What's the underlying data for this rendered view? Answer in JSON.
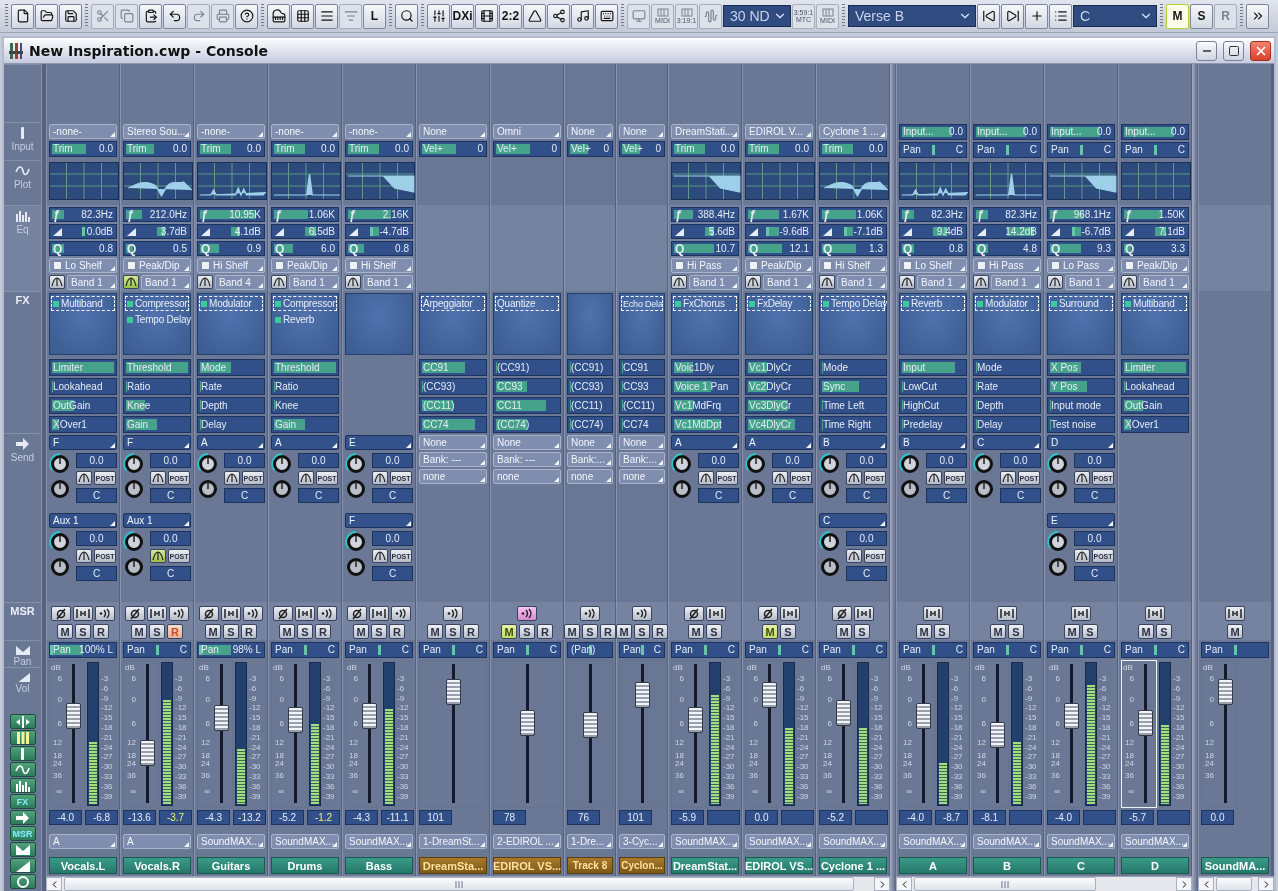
{
  "toolbar": {
    "groups": [
      [
        {
          "kind": "icon",
          "disabled": false
        },
        {
          "kind": "icon",
          "disabled": false
        },
        {
          "kind": "icon",
          "disabled": false
        }
      ],
      [
        {
          "kind": "icon",
          "disabled": true
        },
        {
          "kind": "icon",
          "disabled": true
        },
        {
          "kind": "icon",
          "disabled": false
        },
        {
          "kind": "icon",
          "disabled": false
        },
        {
          "kind": "icon",
          "disabled": true
        },
        {
          "kind": "icon",
          "disabled": true
        },
        {
          "kind": "icon",
          "disabled": false
        }
      ],
      [
        {
          "kind": "icon",
          "disabled": false
        },
        {
          "kind": "icon",
          "disabled": false
        },
        {
          "kind": "icon",
          "disabled": false
        },
        {
          "kind": "icon",
          "disabled": true
        },
        {
          "kind": "text",
          "label": "L",
          "disabled": false
        }
      ],
      [
        {
          "kind": "icon",
          "disabled": false
        }
      ],
      [
        {
          "kind": "icon",
          "disabled": false
        },
        {
          "kind": "text",
          "label": "DXi",
          "disabled": false
        },
        {
          "kind": "icon",
          "disabled": false
        },
        {
          "kind": "text",
          "label": "2:2",
          "disabled": false
        },
        {
          "kind": "icon",
          "disabled": false
        },
        {
          "kind": "icon",
          "disabled": false
        },
        {
          "kind": "icon",
          "disabled": false
        },
        {
          "kind": "icon",
          "disabled": false
        }
      ],
      [
        {
          "kind": "icon",
          "disabled": true
        },
        {
          "kind": "stack",
          "label": "MIDI",
          "disabled": true
        },
        {
          "kind": "stack",
          "label": "3:19:1",
          "disabled": true
        },
        {
          "kind": "icon",
          "disabled": true
        },
        {
          "kind": "select",
          "label": "30 ND",
          "disabled": false
        },
        {
          "kind": "stack",
          "top": "3:59:1",
          "label": "MTC",
          "disabled": true
        },
        {
          "kind": "stack",
          "label": "MIDI",
          "disabled": true
        }
      ],
      [
        {
          "kind": "select",
          "label": "Verse B",
          "disabled": false
        },
        {
          "kind": "icon",
          "disabled": false
        },
        {
          "kind": "icon",
          "disabled": false
        },
        {
          "kind": "icon",
          "disabled": false
        },
        {
          "kind": "icon",
          "disabled": false
        },
        {
          "kind": "select",
          "label": "C",
          "disabled": false
        }
      ],
      [
        {
          "kind": "text",
          "label": "M",
          "disabled": false,
          "selected": true
        },
        {
          "kind": "text",
          "label": "S",
          "disabled": false,
          "selected": false
        },
        {
          "kind": "text",
          "label": "R",
          "disabled": true,
          "selected": false
        }
      ],
      [
        {
          "kind": "icon",
          "disabled": false
        }
      ]
    ]
  },
  "window": {
    "title": "New Inspiration.cwp - Console"
  },
  "sidebar": {
    "sections": [
      {
        "label": "Input"
      },
      {
        "label": "Plot"
      },
      {
        "label": "Eq"
      },
      {
        "label": "FX"
      },
      {
        "label": "Send"
      },
      {
        "label": "MSR"
      },
      {
        "label": "Pan"
      },
      {
        "label": "Vol"
      }
    ],
    "toggles": [
      {
        "kind": "icon"
      },
      {
        "kind": "icon"
      },
      {
        "kind": "icon"
      },
      {
        "kind": "icon"
      },
      {
        "kind": "icon"
      },
      {
        "kind": "text",
        "label": "FX"
      },
      {
        "kind": "icon"
      },
      {
        "kind": "text",
        "label": "MSR"
      },
      {
        "kind": "icon"
      },
      {
        "kind": "icon"
      },
      {
        "kind": "icon"
      }
    ]
  },
  "strips": [
    {
      "kind": "audio",
      "compact": false,
      "input": "-none-",
      "trim": {
        "label": "Trim",
        "value": "0.0",
        "level": 0.55
      },
      "eq": {
        "freq": {
          "symbol": "ƒ",
          "value": "82.3Hz",
          "level": 0.2
        },
        "gain": {
          "value": "0.0dB",
          "level": 0.5
        },
        "q": {
          "symbol": "Q",
          "value": "0.8",
          "level": 0.2
        },
        "type": "Lo Shelf",
        "enabled": false,
        "band": "Band 1",
        "band_on": false
      },
      "fx": [
        {
          "name": "Multiband",
          "selected": true
        }
      ],
      "params": [
        {
          "label": "Limiter",
          "level": 1
        },
        {
          "label": "Lookahead",
          "level": 0
        },
        {
          "label": "OutGain",
          "level": 0.35
        },
        {
          "label": "XOver1",
          "level": 0.12
        }
      ],
      "sends": [
        {
          "bus": "F",
          "value": "0.0",
          "mode": "POST",
          "pan": "C",
          "linked": false
        },
        {
          "bus": "Aux 1",
          "value": "0.0",
          "mode": "POST",
          "pan": "C",
          "linked": false
        }
      ],
      "msr_icons": [
        {
          "kind": "phase",
          "on": false
        },
        {
          "kind": "interleave",
          "on": false
        },
        {
          "kind": "echo",
          "on": false
        }
      ],
      "msr": [
        {
          "label": "M",
          "on": false
        },
        {
          "label": "S",
          "on": false
        },
        {
          "label": "R",
          "on": false
        }
      ],
      "pan": {
        "label": "Pan",
        "value": "100% L",
        "level": 0
      },
      "fader": {
        "level": 0.63,
        "value": "-4.0",
        "focused": false
      },
      "meter": {
        "level": 0.45,
        "value": "-6.8",
        "hot": false
      },
      "db": "dB",
      "scale": [
        "6",
        "0",
        "6",
        "12",
        "18",
        "24",
        "36",
        "∞"
      ],
      "meter_scale": [
        "-3",
        "-6",
        "-9",
        "-12",
        "-15",
        "-18",
        "-21",
        "-24",
        "-27",
        "-30",
        "-33",
        "-36",
        "-39"
      ],
      "output": "A",
      "name": "Vocals.L"
    },
    {
      "kind": "audio",
      "compact": false,
      "input": "Stereo Sou...",
      "trim": {
        "label": "Trim",
        "value": "0.0",
        "level": 0.45
      },
      "eq": {
        "freq": {
          "symbol": "ƒ",
          "value": "212.0Hz",
          "level": 0.25
        },
        "gain": {
          "value": "3.7dB",
          "level": 0.6
        },
        "q": {
          "symbol": "Q",
          "value": "0.5",
          "level": 0.12
        },
        "type": "Peak/Dip",
        "enabled": false,
        "band": "Band 1",
        "band_on": true
      },
      "fx": [
        {
          "name": "Compressor",
          "selected": true
        },
        {
          "name": "Tempo Delay",
          "selected": false
        }
      ],
      "params": [
        {
          "label": "Threshold",
          "level": 1
        },
        {
          "label": "Ratio",
          "level": 0
        },
        {
          "label": "Knee",
          "level": 0.3
        },
        {
          "label": "Gain",
          "level": 0.5
        }
      ],
      "sends": [
        {
          "bus": "F",
          "value": "0.0",
          "mode": "POST",
          "pan": "C",
          "linked": false
        },
        {
          "bus": "Aux 1",
          "value": "0.0",
          "mode": "POST",
          "pan": "C",
          "linked": true
        }
      ],
      "msr_icons": [
        {
          "kind": "phase",
          "on": false
        },
        {
          "kind": "interleave",
          "on": false
        },
        {
          "kind": "echo",
          "on": false
        }
      ],
      "msr": [
        {
          "label": "M",
          "on": false
        },
        {
          "label": "S",
          "on": false
        },
        {
          "label": "R",
          "on": true
        }
      ],
      "pan": {
        "label": "Pan",
        "value": "C",
        "level": 0.5
      },
      "fader": {
        "level": 0.37,
        "value": "-13.6",
        "focused": false
      },
      "meter": {
        "level": 0.75,
        "value": "-3.7",
        "hot": true
      },
      "db": "dB",
      "scale": [
        "6",
        "0",
        "6",
        "12",
        "18",
        "24",
        "36",
        "∞"
      ],
      "meter_scale": [
        "-3",
        "-6",
        "-9",
        "-12",
        "-15",
        "-18",
        "-21",
        "-24",
        "-27",
        "-30",
        "-33",
        "-36",
        "-39"
      ],
      "output": "A",
      "name": "Vocals.R"
    },
    {
      "kind": "audio",
      "compact": false,
      "input": "-none-",
      "trim": {
        "label": "Trim",
        "value": "0.0",
        "level": 0.5
      },
      "eq": {
        "freq": {
          "symbol": "ƒ",
          "value": "10.95K",
          "level": 0.9
        },
        "gain": {
          "value": "4.1dB",
          "level": 0.62
        },
        "q": {
          "symbol": "Q",
          "value": "0.9",
          "level": 0.3
        },
        "type": "Hi Shelf",
        "enabled": false,
        "band": "Band 4",
        "band_on": false
      },
      "fx": [
        {
          "name": "Modulator",
          "selected": true
        }
      ],
      "params": [
        {
          "label": "Mode",
          "level": 0.5
        },
        {
          "label": "Rate",
          "level": 0
        },
        {
          "label": "Depth",
          "level": 0
        },
        {
          "label": "Delay",
          "level": 0
        }
      ],
      "sends": [
        {
          "bus": "A",
          "value": "0.0",
          "mode": "POST",
          "pan": "C",
          "linked": false
        }
      ],
      "msr_icons": [
        {
          "kind": "phase",
          "on": false
        },
        {
          "kind": "interleave",
          "on": false
        },
        {
          "kind": "echo",
          "on": false
        }
      ],
      "msr": [
        {
          "label": "M",
          "on": false
        },
        {
          "label": "S",
          "on": false
        },
        {
          "label": "R",
          "on": false
        }
      ],
      "pan": {
        "label": "Pan",
        "value": "98% L",
        "level": 0.01
      },
      "fader": {
        "level": 0.62,
        "value": "-4.3",
        "focused": false
      },
      "meter": {
        "level": 0.4,
        "value": "-13.2",
        "hot": false
      },
      "db": "dB",
      "scale": [
        "6",
        "0",
        "6",
        "12",
        "18",
        "24",
        "36",
        "∞"
      ],
      "meter_scale": [
        "-3",
        "-6",
        "-9",
        "-12",
        "-15",
        "-18",
        "-21",
        "-24",
        "-27",
        "-30",
        "-33",
        "-36",
        "-39"
      ],
      "output": "SoundMAX...",
      "name": "Guitars"
    },
    {
      "kind": "audio",
      "compact": false,
      "input": "-none-",
      "trim": {
        "label": "Trim",
        "value": "0.0",
        "level": 0.5
      },
      "eq": {
        "freq": {
          "symbol": "ƒ",
          "value": "1.06K",
          "level": 0.55
        },
        "gain": {
          "value": "6.5dB",
          "level": 0.65
        },
        "q": {
          "symbol": "Q",
          "value": "6.0",
          "level": 0.3
        },
        "type": "Peak/Dip",
        "enabled": false,
        "band": "Band 1",
        "band_on": false
      },
      "fx": [
        {
          "name": "Compressor",
          "selected": true
        },
        {
          "name": "Reverb",
          "selected": false
        }
      ],
      "params": [
        {
          "label": "Threshold",
          "level": 1
        },
        {
          "label": "Ratio",
          "level": 0
        },
        {
          "label": "Knee",
          "level": 0
        },
        {
          "label": "Gain",
          "level": 0.5
        }
      ],
      "sends": [
        {
          "bus": "A",
          "value": "0.0",
          "mode": "POST",
          "pan": "C",
          "linked": false
        }
      ],
      "msr_icons": [
        {
          "kind": "phase",
          "on": false
        },
        {
          "kind": "interleave",
          "on": false
        },
        {
          "kind": "echo",
          "on": false
        }
      ],
      "msr": [
        {
          "label": "M",
          "on": false
        },
        {
          "label": "S",
          "on": false
        },
        {
          "label": "R",
          "on": false
        }
      ],
      "pan": {
        "label": "Pan",
        "value": "C",
        "level": 0.5
      },
      "fader": {
        "level": 0.6,
        "value": "-5.2",
        "focused": false
      },
      "meter": {
        "level": 0.58,
        "value": "-1.2",
        "hot": true
      },
      "db": "dB",
      "scale": [
        "6",
        "0",
        "6",
        "12",
        "18",
        "24",
        "36",
        "∞"
      ],
      "meter_scale": [
        "-3",
        "-6",
        "-9",
        "-12",
        "-15",
        "-18",
        "-21",
        "-24",
        "-27",
        "-30",
        "-33",
        "-36",
        "-39"
      ],
      "output": "SoundMAX...",
      "name": "Drums"
    },
    {
      "kind": "audio",
      "compact": false,
      "input": "-none-",
      "trim": {
        "label": "Trim",
        "value": "0.0",
        "level": 0.5
      },
      "eq": {
        "freq": {
          "symbol": "ƒ",
          "value": "2.16K",
          "level": 0.7
        },
        "gain": {
          "value": "-4.7dB",
          "level": 0.38
        },
        "q": {
          "symbol": "Q",
          "value": "0.8",
          "level": 0.25
        },
        "type": "Hi Shelf",
        "enabled": false,
        "band": "Band 1",
        "band_on": false
      },
      "sends": [
        {
          "bus": "E",
          "value": "0.0",
          "mode": "POST",
          "pan": "C",
          "linked": false
        },
        {
          "bus": "F",
          "value": "0.0",
          "mode": "POST",
          "pan": "C",
          "linked": false
        }
      ],
      "msr_icons": [
        {
          "kind": "phase",
          "on": false
        },
        {
          "kind": "interleave",
          "on": false
        },
        {
          "kind": "echo",
          "on": false
        }
      ],
      "msr": [
        {
          "label": "M",
          "on": false
        },
        {
          "label": "S",
          "on": false
        },
        {
          "label": "R",
          "on": false
        }
      ],
      "pan": {
        "label": "Pan",
        "value": "C",
        "level": 0.5
      },
      "fader": {
        "level": 0.63,
        "value": "-4.3",
        "focused": false
      },
      "meter": {
        "level": 0.68,
        "value": "-11.1",
        "hot": false
      },
      "db": "dB",
      "scale": [
        "6",
        "0",
        "6",
        "12",
        "18",
        "24",
        "36",
        "∞"
      ],
      "meter_scale": [
        "-3",
        "-6",
        "-9",
        "-12",
        "-15",
        "-18",
        "-21",
        "-24",
        "-27",
        "-30",
        "-33",
        "-36",
        "-39"
      ],
      "output": "SoundMAX...",
      "name": "Bass"
    },
    {
      "kind": "midi",
      "compact": false,
      "input": "None",
      "trim": {
        "label": "Vel+",
        "value": "0",
        "level": 0.55
      },
      "fx": [
        {
          "name": "Arpeggiator",
          "selected": true
        }
      ],
      "params": [
        {
          "label": "CC91",
          "level": 0.7
        },
        {
          "label": "(CC93)",
          "level": 0
        },
        {
          "label": "(CC11)",
          "level": 0.5
        },
        {
          "label": "CC74",
          "level": 0.85
        }
      ],
      "patch": [
        "None",
        "Bank: ---",
        "none"
      ],
      "msr_icons": [
        {
          "kind": "echo",
          "on": false
        }
      ],
      "msr": [
        {
          "label": "M",
          "on": false
        },
        {
          "label": "S",
          "on": false
        },
        {
          "label": "R",
          "on": false
        }
      ],
      "pan": {
        "label": "Pan",
        "value": "C",
        "level": 0.5
      },
      "fader": {
        "level": 0.8,
        "value": "101",
        "focused": false
      },
      "output": "1-DreamSt...",
      "name": "DreamSta..."
    },
    {
      "kind": "midi",
      "compact": false,
      "input": "Omni",
      "trim": {
        "label": "Vel+",
        "value": "0",
        "level": 0.55
      },
      "fx": [
        {
          "name": "Quantize",
          "selected": true
        }
      ],
      "params": [
        {
          "label": "(CC91)",
          "level": 0
        },
        {
          "label": "CC93",
          "level": 0.5
        },
        {
          "label": "CC11",
          "level": 0.8
        },
        {
          "label": "(CC74)",
          "level": 0.5
        }
      ],
      "patch": [
        "None",
        "Bank: ---",
        "none"
      ],
      "msr_icons": [
        {
          "kind": "echo",
          "on": true
        }
      ],
      "msr": [
        {
          "label": "M",
          "on": true
        },
        {
          "label": "S",
          "on": false
        },
        {
          "label": "R",
          "on": false
        }
      ],
      "pan": {
        "label": "Pan",
        "value": "C",
        "level": 0.5
      },
      "fader": {
        "level": 0.58,
        "value": "78",
        "focused": false
      },
      "output": "2-EDIROL ...",
      "name": "EDIROL VS..."
    },
    {
      "kind": "midi",
      "compact": true,
      "input": "None",
      "trim": {
        "label": "Vel+",
        "value": "0",
        "level": 0.45
      },
      "params": [
        {
          "label": "(CC91)",
          "level": 0
        },
        {
          "label": "(CC93)",
          "level": 0
        },
        {
          "label": "(CC11)",
          "level": 0
        },
        {
          "label": "(CC74)",
          "level": 0
        }
      ],
      "patch": [
        "None",
        "Bank:...",
        "none"
      ],
      "msr_icons": [
        {
          "kind": "echo",
          "on": false
        }
      ],
      "msr": [
        {
          "label": "M",
          "on": false
        },
        {
          "label": "S",
          "on": false
        },
        {
          "label": "R",
          "on": false
        }
      ],
      "pan": {
        "label": "(Pan)",
        "level": 0.5
      },
      "fader": {
        "level": 0.57,
        "value": "76",
        "focused": false
      },
      "output": "1-Dre...",
      "name": "Track 8"
    },
    {
      "kind": "midi",
      "compact": true,
      "input": "None",
      "trim": {
        "label": "Vel+",
        "value": "0",
        "level": 0.45
      },
      "fx": [
        {
          "name": "Echo Dela",
          "selected": true
        }
      ],
      "params": [
        {
          "label": "CC91",
          "level": 0
        },
        {
          "label": "CC93",
          "level": 0
        },
        {
          "label": "(CC11)",
          "level": 0
        },
        {
          "label": "CC74",
          "level": 0
        }
      ],
      "patch": [
        "None",
        "Bank:...",
        "none"
      ],
      "msr_icons": [
        {
          "kind": "echo",
          "on": false
        }
      ],
      "msr": [
        {
          "label": "M",
          "on": false
        },
        {
          "label": "S",
          "on": false
        },
        {
          "label": "R",
          "on": false
        }
      ],
      "pan": {
        "label": "Pan",
        "value": "C",
        "level": 0.5
      },
      "fader": {
        "level": 0.78,
        "value": "101",
        "focused": false
      },
      "output": "3-Cyc...",
      "name": "Cyclon..."
    },
    {
      "kind": "audio",
      "compact": false,
      "input": "DreamStati...",
      "trim": {
        "label": "Trim",
        "value": "0.0",
        "level": 0.5
      },
      "eq": {
        "freq": {
          "symbol": "ƒ",
          "value": "388.4Hz",
          "level": 0.3
        },
        "gain": {
          "value": "5.6dB",
          "level": 0.62
        },
        "q": {
          "symbol": "Q",
          "value": "10.7",
          "level": 0.65
        },
        "type": "Hi Pass",
        "enabled": false,
        "band": "Band 1",
        "band_on": false
      },
      "fx": [
        {
          "name": "FxChorus",
          "selected": true
        }
      ],
      "params": [
        {
          "label": "Voic1Dly",
          "level": 0.3
        },
        {
          "label": "Voice 1 Pan",
          "level": 0.6
        },
        {
          "label": "Vc1MdFrq",
          "level": 0.3
        },
        {
          "label": "Vc1MdDpt",
          "level": 0.75
        }
      ],
      "sends": [
        {
          "bus": "A",
          "value": "0.0",
          "mode": "POST",
          "pan": "C",
          "linked": false
        }
      ],
      "msr_icons": [
        {
          "kind": "phase",
          "on": false
        },
        {
          "kind": "interleave",
          "on": false
        }
      ],
      "msr": [
        {
          "label": "M",
          "on": false
        },
        {
          "label": "S",
          "on": false
        }
      ],
      "pan": {
        "label": "Pan",
        "value": "C",
        "level": 0.5
      },
      "fader": {
        "level": 0.6,
        "value": "-5.9",
        "focused": false
      },
      "meter": {
        "level": 0.78
      },
      "db": "dB",
      "scale": [
        "6",
        "0",
        "6",
        "12",
        "18",
        "24",
        "36",
        "∞"
      ],
      "meter_scale": [
        "-3",
        "-6",
        "-9",
        "-12",
        "-15",
        "-18",
        "-21",
        "-24",
        "-27",
        "-30",
        "-33",
        "-36",
        "-39"
      ],
      "output": "SoundMAX...",
      "name": "DreamStat..."
    },
    {
      "kind": "audio",
      "compact": false,
      "input": "EDIROL V...",
      "trim": {
        "label": "Trim",
        "value": "0.0",
        "level": 0.5
      },
      "eq": {
        "freq": {
          "symbol": "ƒ",
          "value": "1.67K",
          "level": 0.5
        },
        "gain": {
          "value": "-9.6dB",
          "level": 0.32
        },
        "q": {
          "symbol": "Q",
          "value": "12.1",
          "level": 0.55
        },
        "type": "Peak/Dip",
        "enabled": false,
        "band": "Band 1",
        "band_on": false
      },
      "fx": [
        {
          "name": "FxDelay",
          "selected": true
        }
      ],
      "params": [
        {
          "label": "Vc1DlyCr",
          "level": 0.3
        },
        {
          "label": "Vc2DlyCr",
          "level": 0.3
        },
        {
          "label": "Vc3DlyCr",
          "level": 0.65
        },
        {
          "label": "Vc4DlyCr",
          "level": 0.75
        }
      ],
      "sends": [
        {
          "bus": "A",
          "value": "0.0",
          "mode": "POST",
          "pan": "C",
          "linked": false
        }
      ],
      "msr_icons": [
        {
          "kind": "phase",
          "on": false
        },
        {
          "kind": "interleave",
          "on": false
        }
      ],
      "msr": [
        {
          "label": "M",
          "on": true
        },
        {
          "label": "S",
          "on": false
        }
      ],
      "pan": {
        "label": "Pan",
        "value": "C",
        "level": 0.5
      },
      "fader": {
        "level": 0.78,
        "value": "0.0",
        "focused": false
      },
      "meter": {
        "level": 0.55
      },
      "db": "dB",
      "scale": [
        "6",
        "0",
        "6",
        "12",
        "18",
        "24",
        "36",
        "∞"
      ],
      "meter_scale": [
        "-3",
        "-6",
        "-9",
        "-12",
        "-15",
        "-18",
        "-21",
        "-24",
        "-27",
        "-30",
        "-33",
        "-36",
        "-39"
      ],
      "output": "SoundMAX...",
      "name": "EDIROL VS..."
    },
    {
      "kind": "audio",
      "compact": false,
      "input": "Cyclone 1 ...",
      "trim": {
        "label": "Trim",
        "value": "0.0",
        "level": 0.5
      },
      "eq": {
        "freq": {
          "symbol": "ƒ",
          "value": "1.06K",
          "level": 0.55
        },
        "gain": {
          "value": "-7.1dB",
          "level": 0.38
        },
        "q": {
          "symbol": "Q",
          "value": "1.3",
          "level": 0.55
        },
        "type": "Hi Shelf",
        "enabled": false,
        "band": "Band 1",
        "band_on": false
      },
      "fx": [
        {
          "name": "Tempo Delay",
          "selected": true
        }
      ],
      "params": [
        {
          "label": "Mode",
          "level": 0
        },
        {
          "label": "Sync",
          "level": 0.6
        },
        {
          "label": "Time Left",
          "level": 0
        },
        {
          "label": "Time Right",
          "level": 0
        }
      ],
      "sends": [
        {
          "bus": "B",
          "value": "0.0",
          "mode": "POST",
          "pan": "C",
          "linked": false
        },
        {
          "bus": "C",
          "value": "0.0",
          "mode": "POST",
          "pan": "C",
          "linked": false
        }
      ],
      "msr_icons": [
        {
          "kind": "phase",
          "on": false
        },
        {
          "kind": "interleave",
          "on": false
        }
      ],
      "msr": [
        {
          "label": "M",
          "on": false
        },
        {
          "label": "S",
          "on": false
        }
      ],
      "pan": {
        "label": "Pan",
        "value": "C",
        "level": 0.5
      },
      "fader": {
        "level": 0.65,
        "value": "-5.2",
        "focused": false
      },
      "meter": {
        "level": 0.55
      },
      "db": "dB",
      "scale": [
        "6",
        "0",
        "6",
        "12",
        "18",
        "24",
        "36",
        "∞"
      ],
      "meter_scale": [
        "-3",
        "-6",
        "-9",
        "-12",
        "-15",
        "-18",
        "-21",
        "-24",
        "-27",
        "-30",
        "-33",
        "-36",
        "-39"
      ],
      "output": "SoundMAX...",
      "name": "Cyclone 1 ..."
    },
    {
      "kind": "bus",
      "compact": false,
      "input": {
        "label": "Input...",
        "value": "0.0",
        "level": 0.8
      },
      "trim": {
        "label": "Pan",
        "value": "C",
        "level": 0.5
      },
      "eq": {
        "freq": {
          "symbol": "ƒ",
          "value": "82.3Hz",
          "level": 0.2
        },
        "gain": {
          "value": "9.4dB",
          "level": 0.7
        },
        "q": {
          "symbol": "Q",
          "value": "0.8",
          "level": 0.2
        },
        "type": "Lo Shelf",
        "enabled": false,
        "band": "Band 1",
        "band_on": false
      },
      "fx": [
        {
          "name": "Reverb",
          "selected": true
        }
      ],
      "params": [
        {
          "label": "Input",
          "level": 0.85
        },
        {
          "label": "LowCut",
          "level": 0
        },
        {
          "label": "HighCut",
          "level": 0
        },
        {
          "label": "Predelay",
          "level": 0
        }
      ],
      "sends": [
        {
          "bus": "B",
          "value": "0.0",
          "mode": "POST",
          "pan": "C",
          "linked": false
        }
      ],
      "msr_icons": [
        {
          "kind": "interleave",
          "on": false
        }
      ],
      "msr": [
        {
          "label": "M",
          "on": false
        },
        {
          "label": "S",
          "on": false
        }
      ],
      "pan": {
        "label": "Pan",
        "value": "C",
        "level": 0.5
      },
      "fader": {
        "level": 0.63,
        "value": "-4.0",
        "focused": false
      },
      "meter": {
        "level": 0.3,
        "value": "-8.7",
        "hot": false
      },
      "db": "dB",
      "scale": [
        "6",
        "0",
        "6",
        "12",
        "18",
        "24",
        "36",
        "∞"
      ],
      "meter_scale": [
        "-3",
        "-6",
        "-9",
        "-12",
        "-15",
        "-18",
        "-21",
        "-24",
        "-27",
        "-30",
        "-33",
        "-36",
        "-39"
      ],
      "output": "SoundMAX...",
      "name": "A"
    },
    {
      "kind": "bus",
      "compact": false,
      "input": {
        "label": "Input...",
        "value": "0.0",
        "level": 0.8
      },
      "trim": {
        "label": "Pan",
        "value": "C",
        "level": 0.5
      },
      "eq": {
        "freq": {
          "symbol": "ƒ",
          "value": "82.3Hz",
          "level": 0.2
        },
        "gain": {
          "value": "14.2dB",
          "level": 0.9
        },
        "q": {
          "symbol": "Q",
          "value": "4.8",
          "level": 0.2
        },
        "type": "Hi Pass",
        "enabled": false,
        "band": "Band 1",
        "band_on": false
      },
      "fx": [
        {
          "name": "Modulator",
          "selected": true
        }
      ],
      "params": [
        {
          "label": "Mode",
          "level": 0
        },
        {
          "label": "Rate",
          "level": 0
        },
        {
          "label": "Depth",
          "level": 0
        },
        {
          "label": "Delay",
          "level": 0
        }
      ],
      "sends": [
        {
          "bus": "C",
          "value": "0.0",
          "mode": "POST",
          "pan": "C",
          "linked": false
        }
      ],
      "msr_icons": [
        {
          "kind": "interleave",
          "on": false
        }
      ],
      "msr": [
        {
          "label": "M",
          "on": false
        },
        {
          "label": "S",
          "on": false
        }
      ],
      "pan": {
        "label": "Pan",
        "value": "C",
        "level": 0.5
      },
      "fader": {
        "level": 0.5,
        "value": "-8.1",
        "focused": false
      },
      "meter": {
        "level": 0.45
      },
      "db": "dB",
      "scale": [
        "6",
        "0",
        "6",
        "12",
        "18",
        "24",
        "36",
        "∞"
      ],
      "meter_scale": [
        "-3",
        "-6",
        "-9",
        "-12",
        "-15",
        "-18",
        "-21",
        "-24",
        "-27",
        "-30",
        "-33",
        "-36",
        "-39"
      ],
      "output": "SoundMAX...",
      "name": "B"
    },
    {
      "kind": "bus",
      "compact": false,
      "input": {
        "label": "Input...",
        "value": "0.0",
        "level": 0.8
      },
      "trim": {
        "label": "Pan",
        "value": "C",
        "level": 0.5
      },
      "eq": {
        "freq": {
          "symbol": "ƒ",
          "value": "968.1Hz",
          "level": 0.55
        },
        "gain": {
          "value": "-6.7dB",
          "level": 0.38
        },
        "q": {
          "symbol": "Q",
          "value": "9.3",
          "level": 0.5
        },
        "type": "Lo Pass",
        "enabled": false,
        "band": "Band 1",
        "band_on": false
      },
      "fx": [
        {
          "name": "Surround",
          "selected": true
        }
      ],
      "params": [
        {
          "label": "X Pos",
          "level": 0.5
        },
        {
          "label": "Y Pos",
          "level": 0.6
        },
        {
          "label": "Input mode",
          "level": 0
        },
        {
          "label": "Test noise",
          "level": 0
        }
      ],
      "sends": [
        {
          "bus": "D",
          "value": "0.0",
          "mode": "POST",
          "pan": "C",
          "linked": false
        },
        {
          "bus": "E",
          "value": "0.0",
          "mode": "POST",
          "pan": "C",
          "linked": false
        }
      ],
      "msr_icons": [
        {
          "kind": "interleave",
          "on": false
        }
      ],
      "msr": [
        {
          "label": "M",
          "on": false
        },
        {
          "label": "S",
          "on": false
        }
      ],
      "pan": {
        "label": "Pan",
        "value": "C",
        "level": 0.5
      },
      "fader": {
        "level": 0.63,
        "value": "-4.0",
        "focused": false
      },
      "meter": {
        "level": 0.85
      },
      "db": "dB",
      "scale": [
        "6",
        "0",
        "6",
        "12",
        "18",
        "24",
        "36",
        "∞"
      ],
      "meter_scale": [
        "-3",
        "-6",
        "-9",
        "-12",
        "-15",
        "-18",
        "-21",
        "-24",
        "-27",
        "-30",
        "-33",
        "-36",
        "-39"
      ],
      "output": "SoundMAX...",
      "name": "C"
    },
    {
      "kind": "bus",
      "compact": false,
      "input": {
        "label": "Input...",
        "value": "0.0",
        "level": 0.8
      },
      "trim": {
        "label": "Pan",
        "value": "C",
        "level": 0.5
      },
      "eq": {
        "freq": {
          "symbol": "ƒ",
          "value": "1.50K",
          "level": 0.6
        },
        "gain": {
          "value": "7.1dB",
          "level": 0.65
        },
        "q": {
          "symbol": "Q",
          "value": "3.3",
          "level": 0.12
        },
        "type": "Peak/Dip",
        "enabled": false,
        "band": "Band 1",
        "band_on": false
      },
      "fx": [
        {
          "name": "Multiband",
          "selected": true
        }
      ],
      "params": [
        {
          "label": "Limiter",
          "level": 1
        },
        {
          "label": "Lookahead",
          "level": 0
        },
        {
          "label": "OutGain",
          "level": 0.3
        },
        {
          "label": "XOver1",
          "level": 0.12
        }
      ],
      "msr_icons": [
        {
          "kind": "interleave",
          "on": false
        }
      ],
      "msr": [
        {
          "label": "M",
          "on": false
        },
        {
          "label": "S",
          "on": false
        }
      ],
      "pan": {
        "label": "Pan",
        "value": "C",
        "level": 0.5
      },
      "fader": {
        "level": 0.58,
        "value": "-5.7",
        "focused": true
      },
      "meter": {
        "level": 0.57
      },
      "db": "dB",
      "scale": [
        "6",
        "0",
        "6",
        "12",
        "18",
        "24",
        "36",
        "∞"
      ],
      "meter_scale": [
        "-3",
        "-6",
        "-9",
        "-12",
        "-15",
        "-18",
        "-21",
        "-24",
        "-27",
        "-30",
        "-33",
        "-36",
        "-39"
      ],
      "output": "SoundMAX...",
      "name": "D"
    },
    {
      "kind": "master",
      "compact": false,
      "msr_icons": [
        {
          "kind": "interleave",
          "on": false
        }
      ],
      "msr": [
        {
          "label": "M",
          "on": false
        }
      ],
      "pan": {
        "label": "Pan",
        "level": 0.5
      },
      "fader": {
        "level": 0.8,
        "value": "0.0",
        "focused": false
      },
      "db": "dB",
      "scale": [
        "6",
        "0",
        "6",
        "12",
        "18",
        "24",
        "36"
      ],
      "name": "SoundMA..."
    }
  ]
}
